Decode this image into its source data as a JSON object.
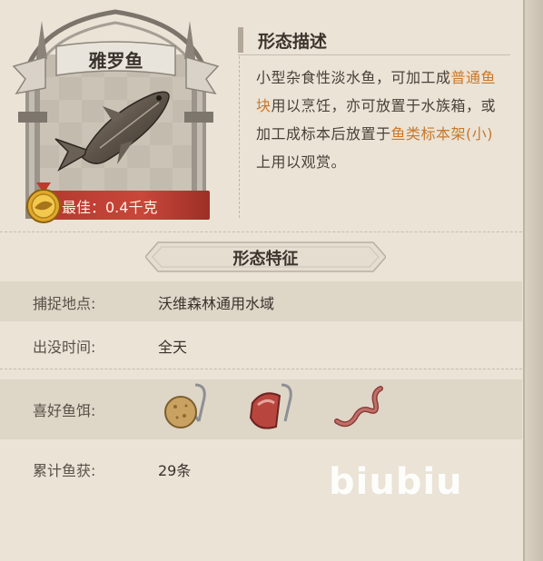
{
  "fish": {
    "name": "雅罗鱼",
    "best_record": "最佳：0.4千克"
  },
  "description": {
    "title": "形态描述",
    "segments": {
      "s1": "小型杂食性淡水鱼，可加工成",
      "link1": "普通鱼块",
      "s2": "用以烹饪，亦可放置于水族箱，或加工成标本后放置于",
      "link2": "鱼类标本架(小)",
      "s3": "上用以观赏。"
    }
  },
  "traits": {
    "title": "形态特征",
    "rows": [
      {
        "label": "捕捉地点:",
        "value": "沃维森林通用水域"
      },
      {
        "label": "出没时间:",
        "value": "全天"
      },
      {
        "label": "喜好鱼饵:",
        "value": ""
      },
      {
        "label": "累计鱼获:",
        "value": "29条"
      }
    ],
    "baits": [
      "bread-bait-icon",
      "meat-bait-icon",
      "worm-bait-icon"
    ]
  },
  "watermark": "biubiu",
  "colors": {
    "paper": "#eae3d6",
    "highlight": "#c8782c",
    "record_bar": "#c9463a"
  }
}
